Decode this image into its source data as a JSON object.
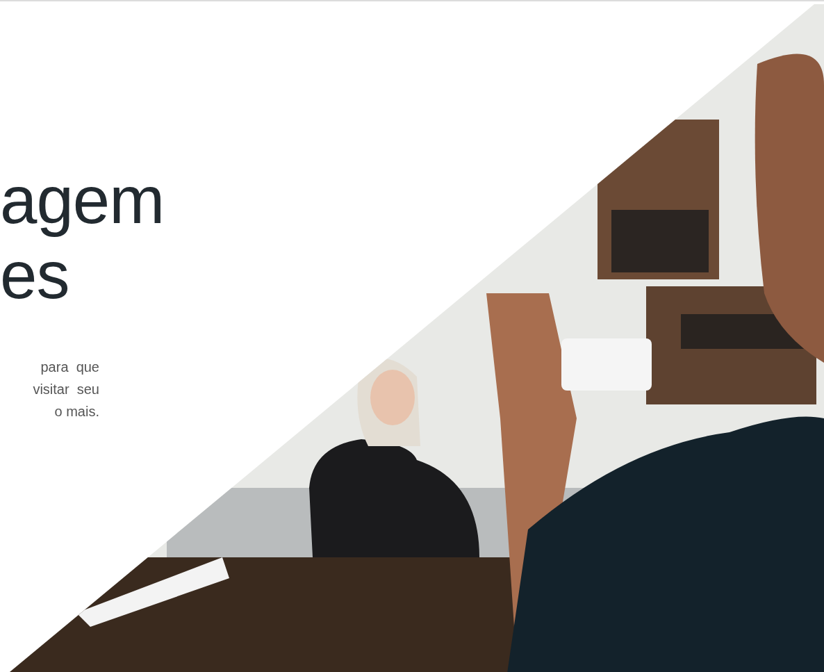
{
  "heading_lines": [
    "agem",
    "es"
  ],
  "paragraph_lines": [
    "para  que",
    "visitar  seu",
    "o mais."
  ],
  "photo": {
    "kind": "picture"
  }
}
